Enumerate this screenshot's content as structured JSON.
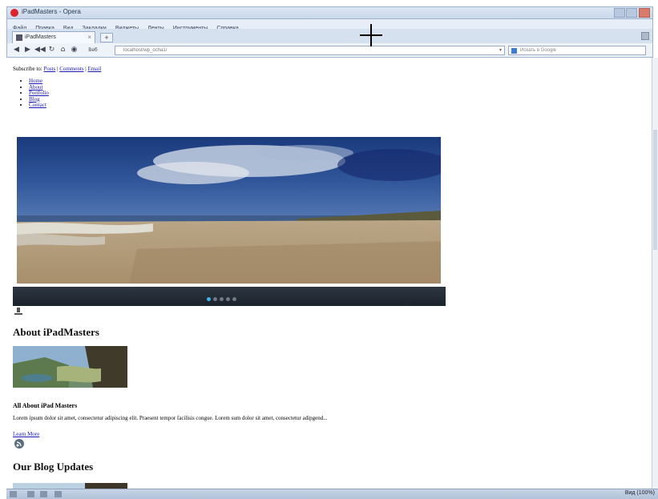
{
  "window": {
    "title": "iPadMasters - Opera",
    "menu": [
      "Файл",
      "Правка",
      "Вид",
      "Закладки",
      "Виджеты",
      "Ленты",
      "Инструменты",
      "Справка"
    ]
  },
  "tabs": [
    {
      "label": "iPadMasters",
      "close": "×"
    }
  ],
  "newtab_label": "+",
  "address": {
    "prefix": "Веб",
    "url": "localhost/wp_ocha1/",
    "dropdown": "▾"
  },
  "search": {
    "placeholder": "Искать в Google"
  },
  "status": {
    "zoom": "Вид (100%)"
  },
  "page": {
    "subscribe_label": "Subscribe to:",
    "subscribe_links": [
      "Posts",
      "Comments",
      "Email"
    ],
    "nav": [
      "Home",
      "About",
      "Portfolio",
      "Blog",
      "Contact"
    ],
    "slider_dots": 5,
    "slider_active": 0,
    "about_heading": "About iPadMasters",
    "sub_heading": "All About iPad Masters",
    "lorem": "Lorem ipsum dolor sit amet, consectetur adipiscing elit. Praesent tempor facilisis congue. Lorem sum dolor sit amet, consectetur adipgend...",
    "learn_more": "Learn More",
    "blog_heading": "Our Blog Updates"
  },
  "colors": {
    "link": "#1a1ab8",
    "slider_bar": "#222a33",
    "active_dot": "#39b5ea"
  }
}
